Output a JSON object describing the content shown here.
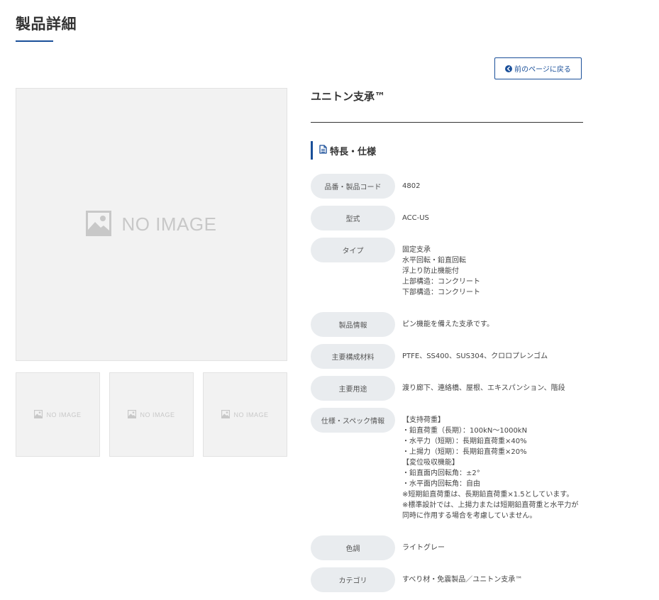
{
  "page": {
    "title": "製品詳細"
  },
  "back_button": {
    "label": "前のページに戻る"
  },
  "images": {
    "main_label": "NO IMAGE",
    "thumb_labels": [
      "NO IMAGE",
      "NO IMAGE",
      "NO IMAGE"
    ]
  },
  "product": {
    "name": "ユニトン支承™"
  },
  "section": {
    "heading": "特長・仕様"
  },
  "specs": [
    {
      "label": "品番・製品コード",
      "lines": [
        "4802"
      ]
    },
    {
      "label": "型式",
      "lines": [
        "ACC-US"
      ]
    },
    {
      "label": "タイプ",
      "lines": [
        "固定支承",
        "水平回転・鉛直回転",
        "浮上り防止機能付",
        "上部構造：コンクリート",
        "下部構造：コンクリート"
      ]
    },
    {
      "label": "製品情報",
      "lines": [
        "ピン機能を備えた支承です。"
      ]
    },
    {
      "label": "主要構成材料",
      "lines": [
        "PTFE、SS400、SUS304、クロロプレンゴム"
      ]
    },
    {
      "label": "主要用途",
      "lines": [
        "渡り廊下、連絡橋、屋根、エキスパンション、階段"
      ]
    },
    {
      "label": "仕様・スペック情報",
      "lines": [
        "【支持荷重】",
        "・鉛直荷重（長期）：100kN～1000kN",
        "・水平力（短期）：長期鉛直荷重×40%",
        "・上揚力（短期）：長期鉛直荷重×20%",
        "【変位吸収機能】",
        "・鉛直面内回転角：±2°",
        "・水平面内回転角：自由",
        "※短期鉛直荷重は、長期鉛直荷重×1.5としています。",
        "※標準設計では、上揚力または短期鉛直荷重と水平力が",
        "同時に作用する場合を考慮していません。"
      ]
    },
    {
      "label": "色調",
      "lines": [
        "ライトグレー"
      ]
    },
    {
      "label": "カテゴリ",
      "lines": [
        "すべり材・免震製品／ユニトン支承™"
      ]
    }
  ],
  "colors": {
    "accent": "#1a4f99",
    "label_bg": "#e9ecef",
    "placeholder_bg": "#f2f2f2",
    "placeholder_text": "#c8c8c8"
  }
}
